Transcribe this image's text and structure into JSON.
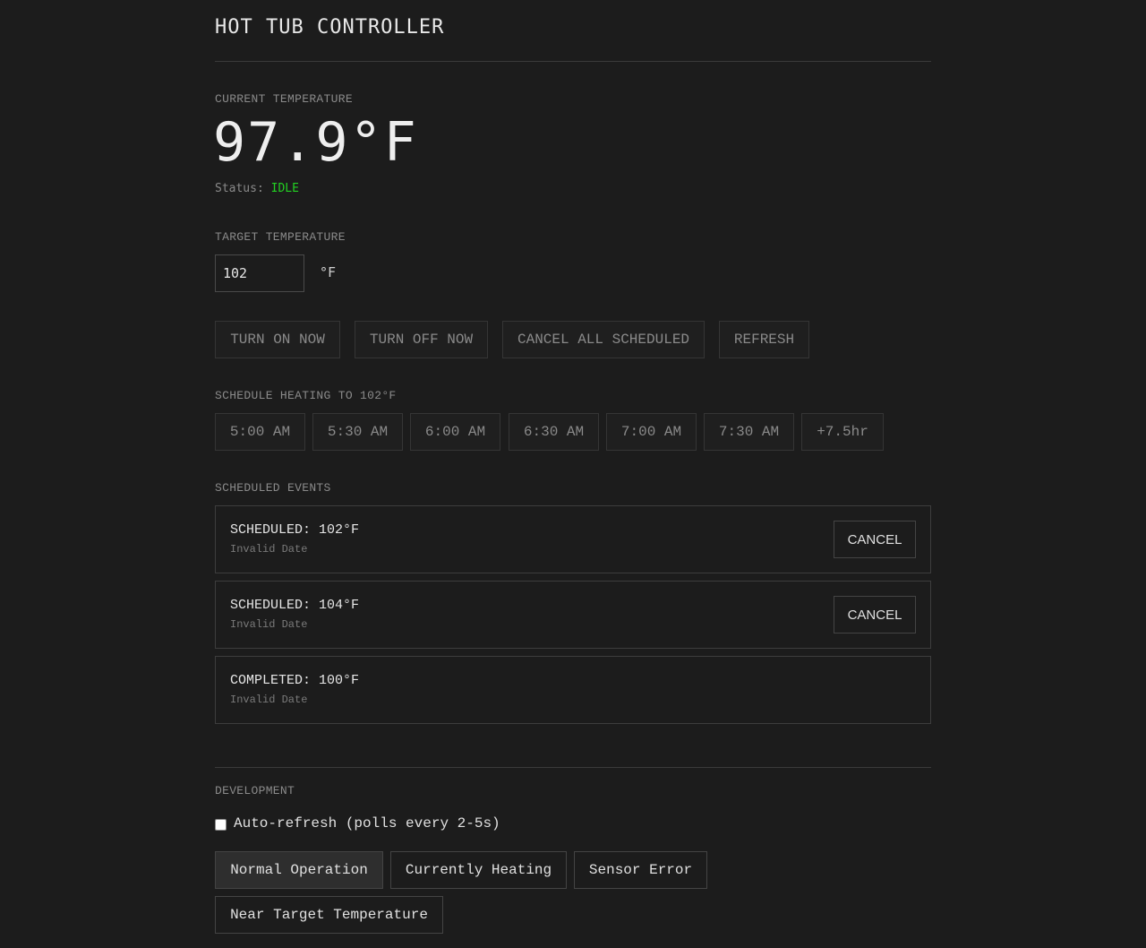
{
  "header": {
    "title": "HOT TUB CONTROLLER"
  },
  "current": {
    "label": "CURRENT TEMPERATURE",
    "temperature": "97.9°F",
    "status_label": "Status:",
    "status_value": "IDLE",
    "status_color": "#22d022"
  },
  "target": {
    "label": "TARGET TEMPERATURE",
    "value": "102",
    "unit": "°F"
  },
  "actions": {
    "turn_on": "TURN ON NOW",
    "turn_off": "TURN OFF NOW",
    "cancel_all": "CANCEL ALL SCHEDULED",
    "refresh": "REFRESH"
  },
  "schedule": {
    "label": "SCHEDULE HEATING TO 102°F",
    "times": [
      "5:00 AM",
      "5:30 AM",
      "6:00 AM",
      "6:30 AM",
      "7:00 AM",
      "7:30 AM",
      "+7.5hr"
    ]
  },
  "events": {
    "label": "SCHEDULED EVENTS",
    "items": [
      {
        "title": "SCHEDULED: 102°F",
        "subtitle": "Invalid Date",
        "cancel_label": "CANCEL"
      },
      {
        "title": "SCHEDULED: 104°F",
        "subtitle": "Invalid Date",
        "cancel_label": "CANCEL"
      },
      {
        "title": "COMPLETED: 100°F",
        "subtitle": "Invalid Date"
      }
    ]
  },
  "development": {
    "label": "DEVELOPMENT",
    "autorefresh_label": "Auto-refresh (polls every 2-5s)",
    "autorefresh_checked": false,
    "scenarios": [
      "Normal Operation",
      "Currently Heating",
      "Sensor Error",
      "Near Target Temperature"
    ],
    "active_scenario": "Normal Operation"
  }
}
